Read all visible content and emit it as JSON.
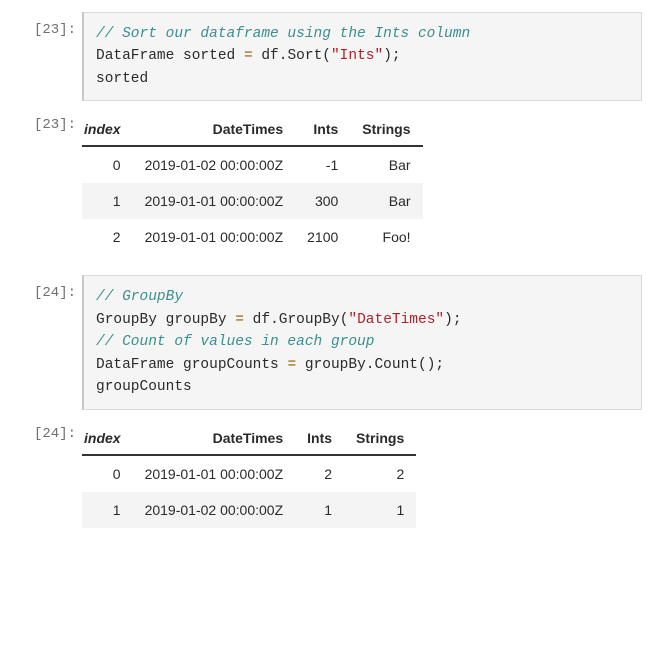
{
  "cells": [
    {
      "prompt": "[23]:",
      "code": {
        "comment1": "// Sort our dataframe using the Ints column",
        "line2_type": "DataFrame",
        "line2_var": "sorted",
        "line2_eq": "=",
        "line2_obj": "df",
        "line2_dot1": ".",
        "line2_method": "Sort",
        "line2_paropen": "(",
        "line2_string": "\"Ints\"",
        "line2_parclose": ")",
        "line2_semi": ";",
        "line3": "sorted"
      }
    },
    {
      "prompt": "[23]:",
      "table": {
        "index_label": "index",
        "headers": [
          "DateTimes",
          "Ints",
          "Strings"
        ],
        "rows": [
          {
            "idx": "0",
            "c0": "2019-01-02 00:00:00Z",
            "c1": "-1",
            "c2": "Bar"
          },
          {
            "idx": "1",
            "c0": "2019-01-01 00:00:00Z",
            "c1": "300",
            "c2": "Bar"
          },
          {
            "idx": "2",
            "c0": "2019-01-01 00:00:00Z",
            "c1": "2100",
            "c2": "Foo!"
          }
        ]
      }
    },
    {
      "prompt": "[24]:",
      "code": {
        "comment1": "// GroupBy",
        "line2_type": "GroupBy",
        "line2_var": "groupBy",
        "line2_eq": "=",
        "line2_obj": "df",
        "line2_dot1": ".",
        "line2_method": "GroupBy",
        "line2_paropen": "(",
        "line2_string": "\"DateTimes\"",
        "line2_parclose": ")",
        "line2_semi": ";",
        "comment2": "// Count of values in each group",
        "line4_type": "DataFrame",
        "line4_var": "groupCounts",
        "line4_eq": "=",
        "line4_obj": "groupBy",
        "line4_dot1": ".",
        "line4_method": "Count",
        "line4_paropen": "(",
        "line4_parclose": ")",
        "line4_semi": ";",
        "line5": "groupCounts"
      }
    },
    {
      "prompt": "[24]:",
      "table": {
        "index_label": "index",
        "headers": [
          "DateTimes",
          "Ints",
          "Strings"
        ],
        "rows": [
          {
            "idx": "0",
            "c0": "2019-01-01 00:00:00Z",
            "c1": "2",
            "c2": "2"
          },
          {
            "idx": "1",
            "c0": "2019-01-02 00:00:00Z",
            "c1": "1",
            "c2": "1"
          }
        ]
      }
    }
  ]
}
